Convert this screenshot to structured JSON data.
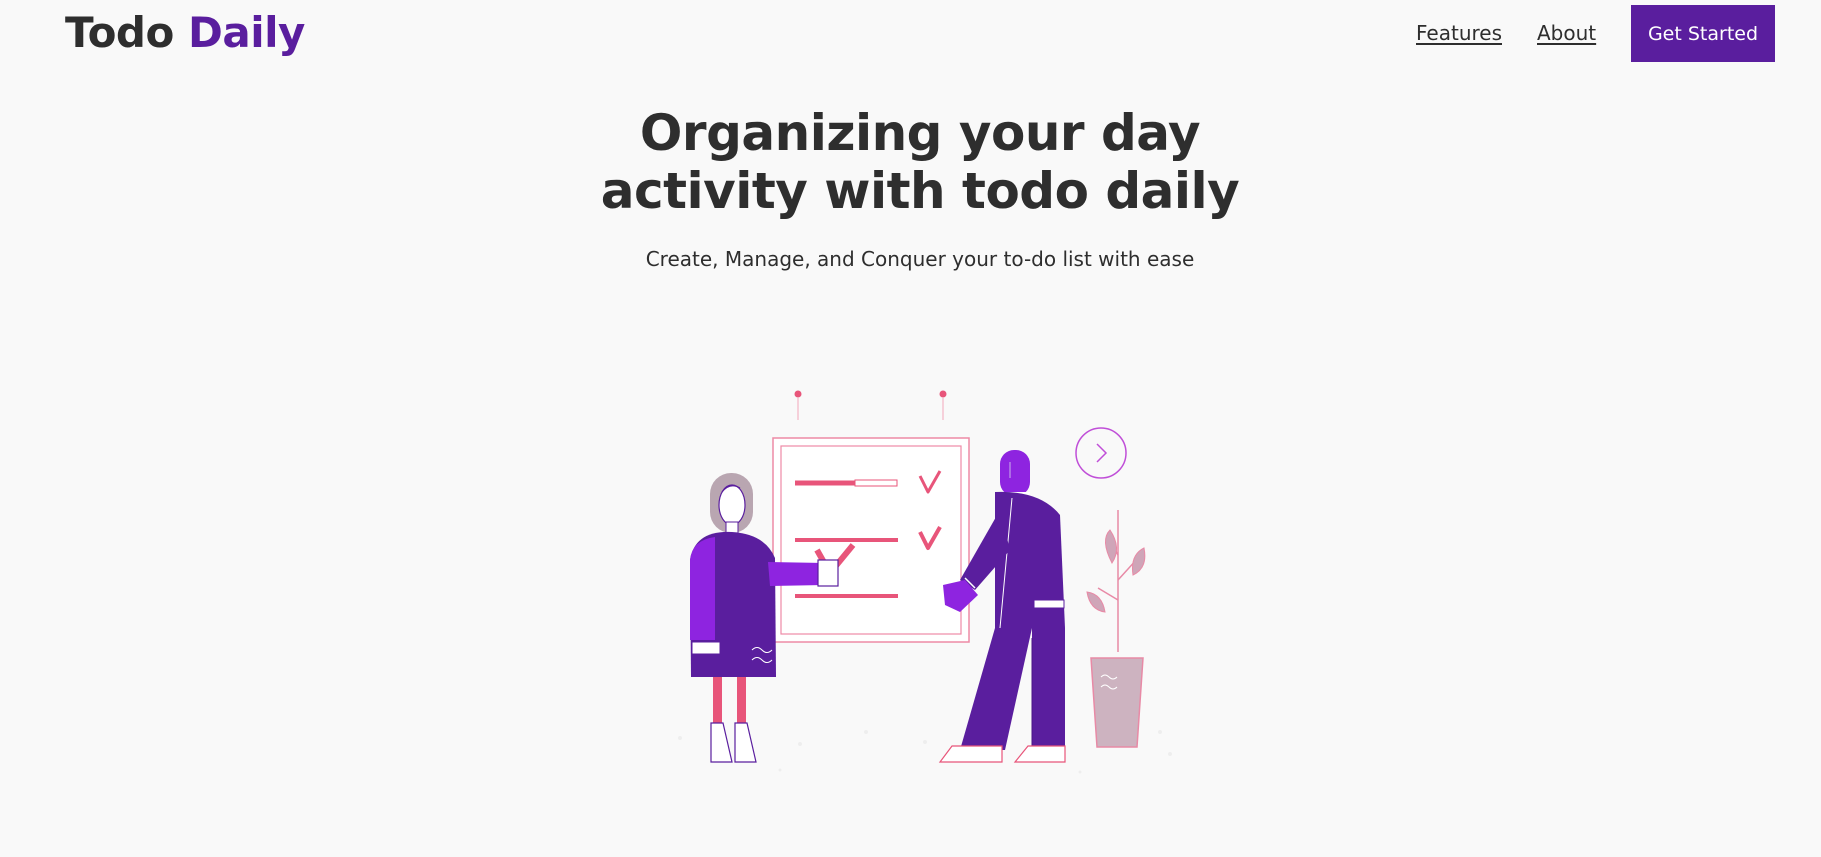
{
  "header": {
    "logo_part1": "Todo",
    "logo_part2": "Daily",
    "nav": {
      "features_label": "Features",
      "about_label": "About"
    },
    "cta_label": "Get Started"
  },
  "hero": {
    "title_line1": "Organizing your day",
    "title_line2": "activity with todo daily",
    "subtitle": "Create, Manage, and Conquer your to-do list with ease"
  },
  "colors": {
    "brand": "#5a1e9e",
    "text": "#2e2e2e",
    "background": "#f9f9f9",
    "accent_pink": "#e8557a"
  },
  "illustration": {
    "icon": "task-board-illustration"
  }
}
